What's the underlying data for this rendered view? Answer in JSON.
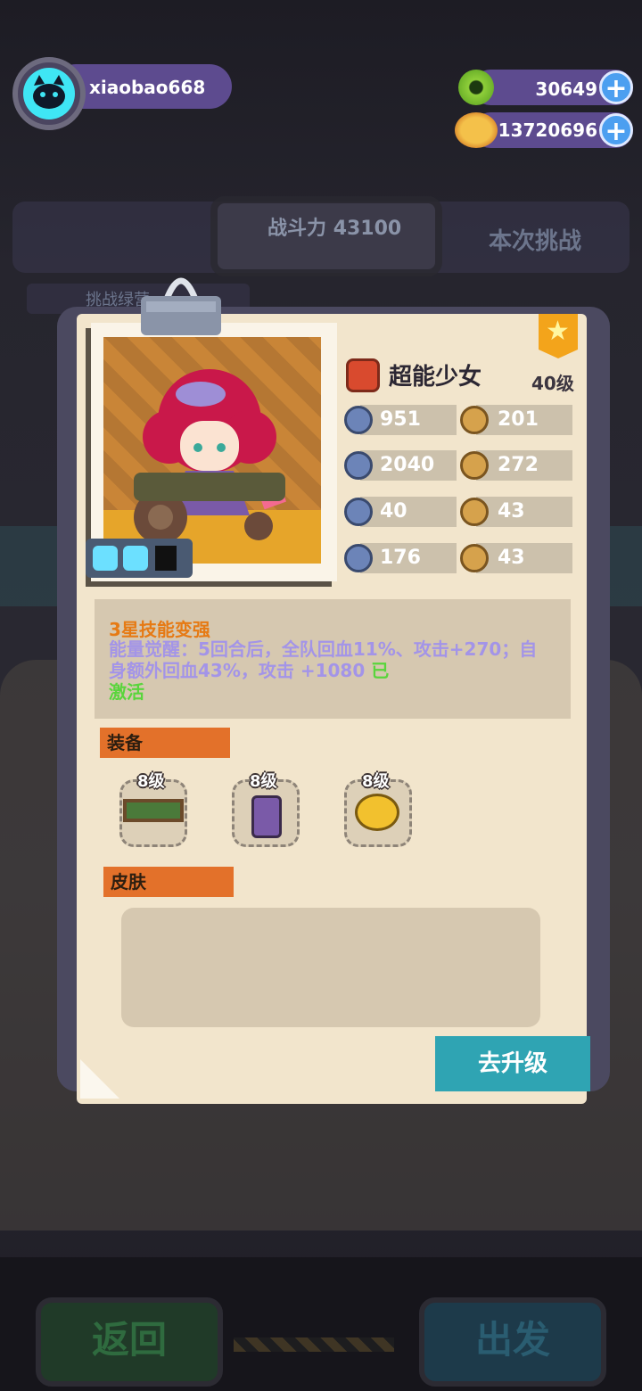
{
  "user": {
    "name": "xiaobao668"
  },
  "currency": [
    {
      "icon": "green-gem-icon",
      "value": "30649"
    },
    {
      "icon": "gold-planet-coin-icon",
      "value": "13720696"
    }
  ],
  "background": {
    "power_label": "战斗力",
    "power_value": "43100",
    "challenge_label": "本次挑战",
    "tab_label": "挑战绿营"
  },
  "hero": {
    "name": "超能少女",
    "level": "40级",
    "stats": [
      {
        "icon": "heart-shield-icon",
        "value": "951"
      },
      {
        "icon": "boot-speed-icon",
        "value": "201"
      },
      {
        "icon": "sword-attack-icon",
        "value": "2040"
      },
      {
        "icon": "coin-face-icon",
        "value": "272"
      },
      {
        "icon": "shield-defense-icon",
        "value": "40"
      },
      {
        "icon": "muscle-icon",
        "value": "43"
      },
      {
        "icon": "trident-icon",
        "value": "176"
      },
      {
        "icon": "brain-icon",
        "value": "43"
      }
    ]
  },
  "skill": {
    "title": "3星技能变强",
    "desc": "能量觉醒：5回合后，全队回血11%、攻击+270；自身额外回血43%，攻击 +1080",
    "status_line1": "已",
    "status_line2": "激活"
  },
  "equipment": {
    "label": "装备",
    "items": [
      {
        "icon": "green-board-icon",
        "level": "8级"
      },
      {
        "icon": "potion-bottle-icon",
        "level": "8级"
      },
      {
        "icon": "gold-ring-icon",
        "level": "8级"
      }
    ]
  },
  "skin": {
    "label": "皮肤"
  },
  "buttons": {
    "upgrade": "去升级",
    "back": "返回",
    "go": "出发"
  },
  "colors": {
    "card": "#f2e5cc",
    "accent_orange": "#e3712a",
    "upgrade_teal": "#2fa4b3",
    "skill_purple": "#a394e8",
    "active_green": "#59d53c"
  }
}
